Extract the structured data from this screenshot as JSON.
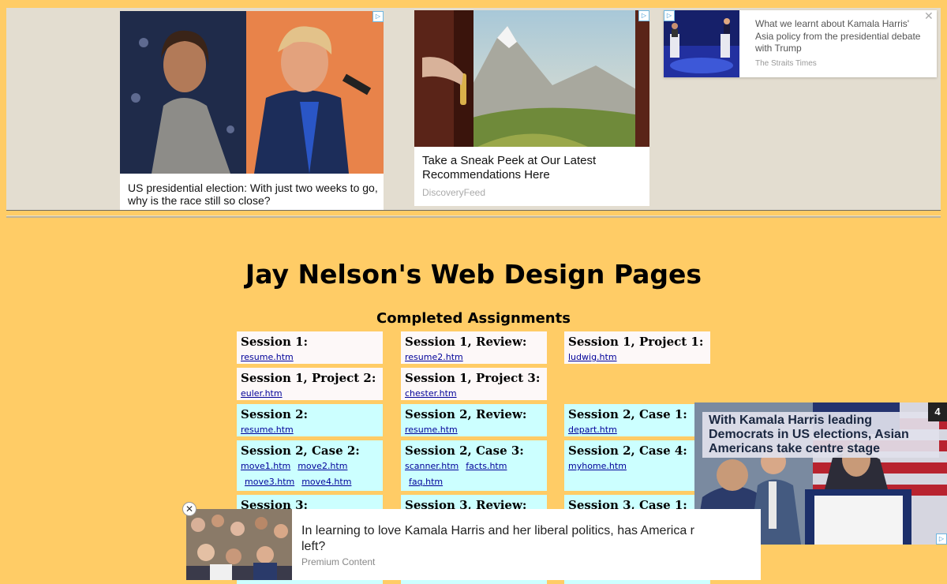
{
  "ads": {
    "card1": {
      "headline": "US presidential election: With just two weeks to go, why is the race still so close?"
    },
    "card2": {
      "headline": "Take a Sneak Peek at Our Latest Recommendations Here",
      "source": "DiscoveryFeed"
    },
    "card3": {
      "headline": "What we learnt about Kamala Harris' Asia policy from the presidential debate with Trump",
      "source": "The Straits Times",
      "close": "✕"
    },
    "adchoices_glyph": "▷"
  },
  "page": {
    "title": "Jay Nelson's Web Design Pages",
    "section_title": "Completed Assignments"
  },
  "assignments": [
    {
      "title": "Session 1:",
      "links": [
        "resume.htm"
      ]
    },
    {
      "title": "Session 1, Review:",
      "links": [
        "resume2.htm"
      ]
    },
    {
      "title": "Session 1, Project 1:",
      "links": [
        "ludwig.htm"
      ]
    },
    {
      "title": "Session 1, Project 2:",
      "links": [
        "euler.htm"
      ]
    },
    {
      "title": "Session 1, Project 3:",
      "links": [
        "chester.htm"
      ]
    },
    {
      "title": "Session 2:",
      "links": [
        "resume.htm"
      ]
    },
    {
      "title": "Session 2, Review:",
      "links": [
        "resume.htm"
      ]
    },
    {
      "title": "Session 2, Case 1:",
      "links": [
        "depart.htm"
      ]
    },
    {
      "title": "Session 2, Case 2:",
      "links": [
        "move1.htm",
        "move2.htm",
        "move3.htm",
        "move4.htm"
      ]
    },
    {
      "title": "Session 2, Case 3:",
      "links": [
        "scanner.htm",
        "facts.htm",
        "faq.htm"
      ]
    },
    {
      "title": "Session 2, Case 4:",
      "links": [
        "myhome.htm"
      ]
    },
    {
      "title": "Session 3:",
      "links": []
    },
    {
      "title": "Session 3, Review:",
      "links": []
    },
    {
      "title": "Session 3, Case 1:",
      "links": []
    }
  ],
  "video_ad": {
    "caption": "With Kamala Harris leading Democrats in US elections, Asian Americans take centre stage",
    "count": "4"
  },
  "bottom_ad": {
    "headline": "In learning to love Kamala Harris and her liberal politics, has America r left?",
    "source": "Premium Content",
    "close": "✕"
  },
  "colors": {
    "page_bg": "#ffcc66",
    "cell_white": "#fdf8f8",
    "cell_cyan": "#ccffff",
    "link": "#000099"
  }
}
